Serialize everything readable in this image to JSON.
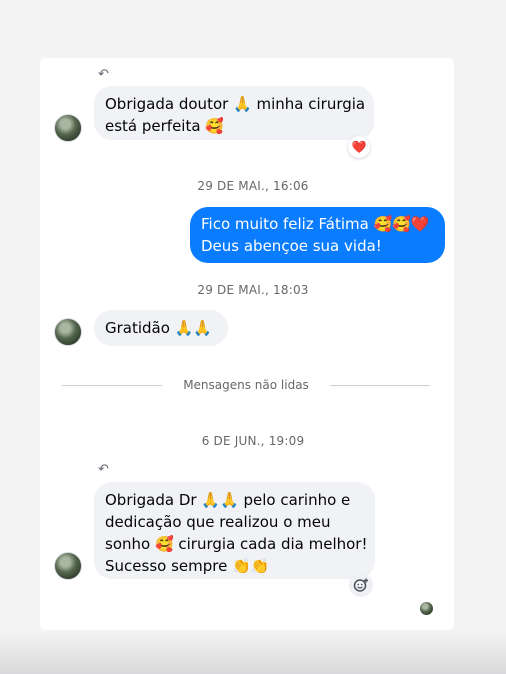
{
  "messages": [
    {
      "lines": [
        "Obrigada doutor 🙏 minha cirurgia",
        "está perfeita 🥰"
      ],
      "reaction": "❤️"
    },
    {
      "timestamp": "29 DE MAI., 16:06",
      "lines": [
        "Fico muito feliz Fátima 🥰🥰❤️",
        "Deus abençoe sua vida!"
      ]
    },
    {
      "timestamp": "29 DE MAI., 18:03",
      "lines": [
        "Gratidão 🙏🙏"
      ]
    },
    {
      "timestamp": "6 DE JUN., 19:09",
      "lines": [
        "Obrigada Dr 🙏🙏 pelo carinho e",
        "dedicação que realizou o meu",
        "sonho 🥰 cirurgia cada dia melhor!",
        "Sucesso sempre 👏👏"
      ]
    }
  ],
  "divider": {
    "label": "Mensagens não lidas"
  },
  "icons": {
    "reply": "reply-arrow-icon",
    "add_reaction": "add-reaction-icon",
    "avatar": "contact-avatar",
    "seen": "seen-avatar"
  },
  "colors": {
    "outgoing_bubble": "#0a7cff",
    "incoming_bubble": "#f0f2f5",
    "timestamp_text": "#65676b"
  }
}
